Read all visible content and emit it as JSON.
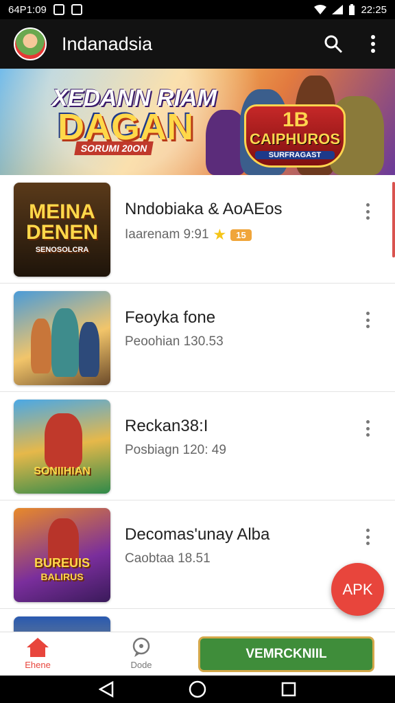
{
  "status_bar": {
    "left_text": "64P1:09",
    "time": "22:25"
  },
  "app_bar": {
    "title": "Indanadsia",
    "icons": [
      "avatar",
      "search-icon",
      "more-vert-icon"
    ]
  },
  "banner": {
    "title_line1": "XEDANN RIAM",
    "title_line2": "DAGAN",
    "subtitle": "SORUMI 20ON",
    "badge_top": "1B",
    "badge_mid": "CAIPHUROS",
    "badge_low": "SURFRAGAST"
  },
  "items": [
    {
      "thumb_text_1": "MEINA",
      "thumb_text_2": "DENEN",
      "thumb_caption": "SENOSOLCRA",
      "title": "Nndobiaka & AoAEos",
      "subtitle": "Iaarenam 9:91",
      "badge": "15",
      "icons": [
        "star-icon"
      ],
      "colors": {
        "thumb": "#3a2714"
      }
    },
    {
      "thumb_text_1": "",
      "thumb_text_2": "",
      "thumb_caption": "",
      "title": "Feoyka fone",
      "subtitle": "Peoohian 130.53",
      "badge": "",
      "colors": {
        "thumb": "#4a9bd8"
      }
    },
    {
      "thumb_text_1": "",
      "thumb_text_2": "SONIIHIAN",
      "thumb_caption": "",
      "title": "Reckan38:I",
      "subtitle": "Posbiagn 120: 49",
      "badge": "",
      "colors": {
        "thumb": "#4aa8e6"
      }
    },
    {
      "thumb_text_1": "",
      "thumb_text_2": "BUREUIS",
      "thumb_caption": "BALIRUS",
      "title": "Decomas'unay Alba",
      "subtitle": "Caobtaa 18.51",
      "badge": "",
      "colors": {
        "thumb": "#7a2e9c"
      }
    }
  ],
  "fab": {
    "label": "APK"
  },
  "bottom_nav": {
    "home_label": "Ehene",
    "second_label": "Dode",
    "download_label": "VEMRCKNIIL"
  },
  "colors": {
    "accent": "#e8453c",
    "download": "#3f8d3a",
    "app_bar": "#121212"
  }
}
